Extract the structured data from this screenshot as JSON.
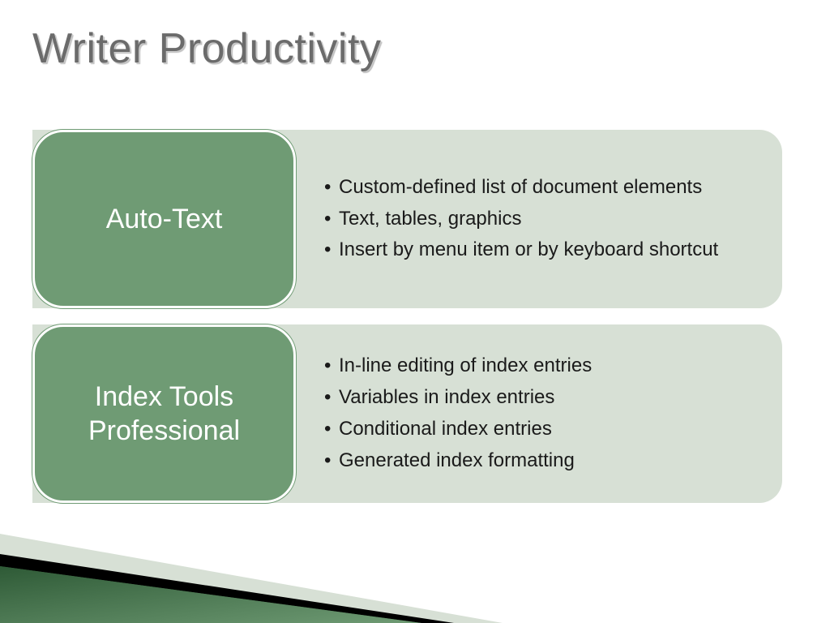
{
  "title": "Writer Productivity",
  "rows": [
    {
      "badge": "Auto-Text",
      "bullets": [
        "Custom-defined list of document elements",
        "Text, tables, graphics",
        "Insert by menu item or by keyboard shortcut"
      ]
    },
    {
      "badge": "Index Tools Professional",
      "bullets": [
        "In-line editing of index entries",
        "Variables in index entries",
        "Conditional index entries",
        "Generated index formatting"
      ]
    }
  ]
}
